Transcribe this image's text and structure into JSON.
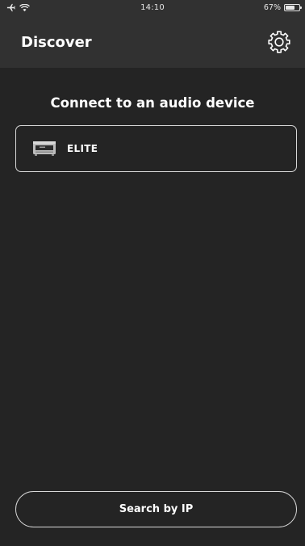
{
  "status_bar": {
    "time": "14:10",
    "battery_text": "67%",
    "battery_level": 0.67,
    "left_icons": [
      "airplane-icon",
      "wifi-icon"
    ]
  },
  "header": {
    "title": "Discover",
    "settings_icon": "gear-icon"
  },
  "main": {
    "heading": "Connect to an audio device",
    "devices": [
      {
        "name": "ELITE",
        "icon": "audio-receiver-icon"
      }
    ]
  },
  "footer": {
    "search_by_ip_label": "Search by IP"
  },
  "colors": {
    "background": "#242424",
    "header_background": "#313131",
    "border": "#d8d8d8",
    "text": "#ffffff"
  }
}
